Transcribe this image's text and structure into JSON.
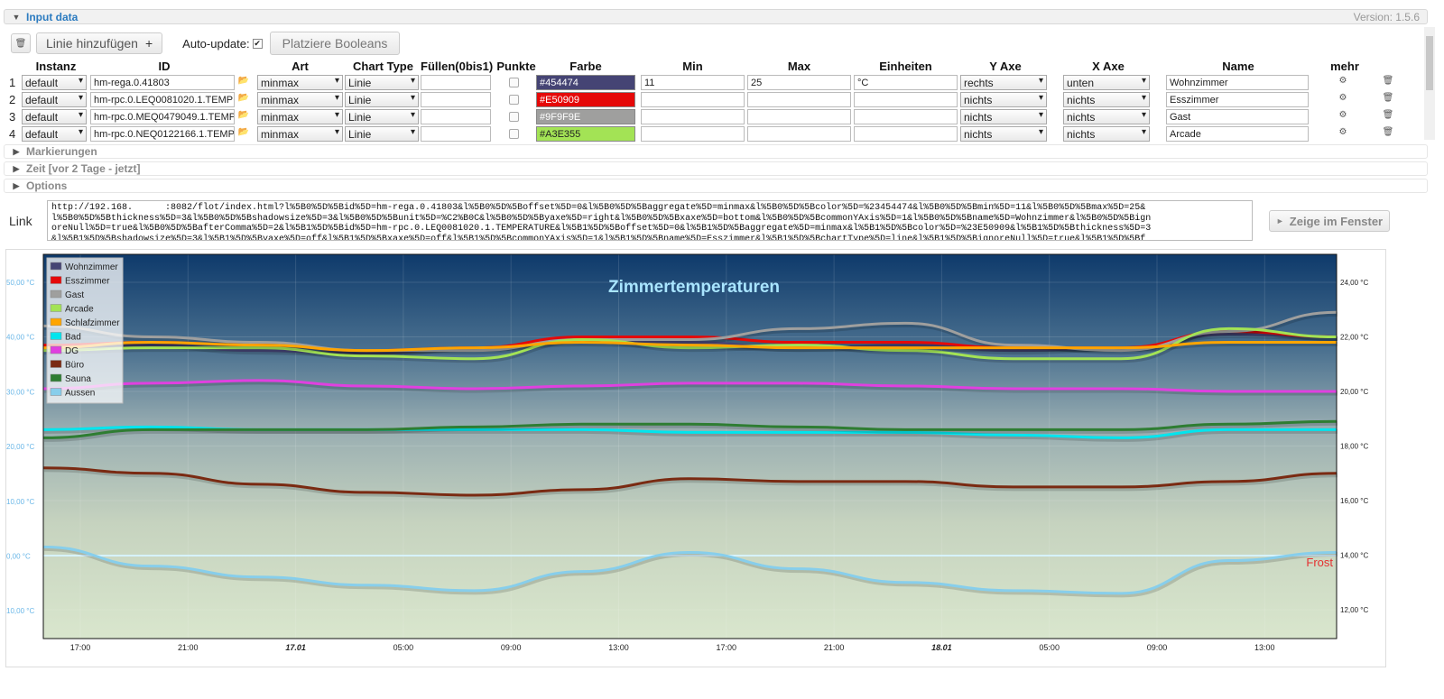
{
  "accordion": {
    "input_data": "Input data",
    "version": "Version: 1.5.6",
    "markierungen": "Markierungen",
    "zeit": "Zeit [vor 2 Tage - jetzt]",
    "options": "Options"
  },
  "toolbar": {
    "add_line": "Linie hinzufügen",
    "plus": "+",
    "auto_update_label": "Auto-update:",
    "auto_update_checked": true,
    "place_booleans": "Platziere Booleans"
  },
  "columns": [
    "Instanz",
    "ID",
    "Art",
    "Chart Type",
    "Füllen(0bis1)",
    "Punkte",
    "Farbe",
    "Min",
    "Max",
    "Einheiten",
    "Y Axe",
    "X Axe",
    "Name",
    "mehr"
  ],
  "rows": [
    {
      "num": "1",
      "instanz": "default",
      "id": "hm-rega.0.41803",
      "art": "minmax",
      "type": "Linie",
      "fill": "",
      "farbe": "#454474",
      "farbe_hex": "#454474",
      "farbe_text_color": "#ffffff",
      "min": "11",
      "max": "25",
      "einheit": "°C",
      "yaxe": "rechts",
      "xaxe": "unten",
      "name": "Wohnzimmer"
    },
    {
      "num": "2",
      "instanz": "default",
      "id": "hm-rpc.0.LEQ0081020.1.TEMPERATURE",
      "art": "minmax",
      "type": "Linie",
      "fill": "",
      "farbe": "#E50909",
      "farbe_hex": "#E50909",
      "farbe_text_color": "#ffffff",
      "min": "",
      "max": "",
      "einheit": "",
      "yaxe": "nichts",
      "xaxe": "nichts",
      "name": "Esszimmer"
    },
    {
      "num": "3",
      "instanz": "default",
      "id": "hm-rpc.0.MEQ0479049.1.TEMPERATURE",
      "art": "minmax",
      "type": "Linie",
      "fill": "",
      "farbe": "#9F9F9E",
      "farbe_hex": "#9F9F9E",
      "farbe_text_color": "#ffffff",
      "min": "",
      "max": "",
      "einheit": "",
      "yaxe": "nichts",
      "xaxe": "nichts",
      "name": "Gast"
    },
    {
      "num": "4",
      "instanz": "default",
      "id": "hm-rpc.0.NEQ0122166.1.TEMPERATURE",
      "art": "minmax",
      "type": "Linie",
      "fill": "",
      "farbe": "#A3E355",
      "farbe_hex": "#A3E355",
      "farbe_text_color": "#222222",
      "min": "",
      "max": "",
      "einheit": "",
      "yaxe": "nichts",
      "xaxe": "nichts",
      "name": "Arcade"
    }
  ],
  "link": {
    "label": "Link",
    "url": "http://192.168.      :8082/flot/index.html?l%5B0%5D%5Bid%5D=hm-rega.0.41803&l%5B0%5D%5Boffset%5D=0&l%5B0%5D%5Baggregate%5D=minmax&l%5B0%5D%5Bcolor%5D=%23454474&l%5B0%5D%5Bmin%5D=11&l%5B0%5D%5Bmax%5D=25&\nl%5B0%5D%5Bthickness%5D=3&l%5B0%5D%5Bshadowsize%5D=3&l%5B0%5D%5Bunit%5D=%C2%B0C&l%5B0%5D%5Byaxe%5D=right&l%5B0%5D%5Bxaxe%5D=bottom&l%5B0%5D%5BcommonYAxis%5D=1&l%5B0%5D%5Bname%5D=Wohnzimmer&l%5B0%5D%5Bign\noreNull%5D=true&l%5B0%5D%5BafterComma%5D=2&l%5B1%5D%5Bid%5D=hm-rpc.0.LEQ0081020.1.TEMPERATURE&l%5B1%5D%5Boffset%5D=0&l%5B1%5D%5Baggregate%5D=minmax&l%5B1%5D%5Bcolor%5D=%23E50909&l%5B1%5D%5Bthickness%5D=3\n&l%5B1%5D%5Bshadowsize%5D=3&l%5B1%5D%5Byaxe%5D=off&l%5B1%5D%5Bxaxe%5D=off&l%5B1%5D%5BcommonYAxis%5D=1&l%5B1%5D%5Bname%5D=Esszimmer&l%5B1%5D%5BchartType%5D=line&l%5B1%5D%5BignoreNull%5D=true&l%5B1%5D%5Bf",
    "show_button": "Zeige im Fenster",
    "play_icon": "►"
  },
  "chart_data": {
    "type": "line",
    "title": "Zimmertemperaturen",
    "annotation": "Frost",
    "left_axis_ticks": [
      "50,00 °C",
      "40,00 °C",
      "30,00 °C",
      "20,00 °C",
      "10,00 °C",
      "0,00 °C",
      "10,00 °C"
    ],
    "right_axis_ticks": [
      "24,00 °C",
      "22,00 °C",
      "20,00 °C",
      "18,00 °C",
      "16,00 °C",
      "14,00 °C",
      "12,00 °C"
    ],
    "right_ylim": [
      11,
      25
    ],
    "x_ticks": [
      "17:00",
      "21:00",
      "17.01",
      "05:00",
      "09:00",
      "13:00",
      "17:00",
      "21:00",
      "18.01",
      "05:00",
      "09:00",
      "13:00"
    ],
    "legend_position": "top-left",
    "series": [
      {
        "name": "Wohnzimmer",
        "color": "#454474",
        "values": [
          21.6,
          21.7,
          21.5,
          21.4,
          21.6,
          21.9,
          21.8,
          21.6,
          21.7,
          21.5,
          21.6,
          22.1,
          22.0
        ]
      },
      {
        "name": "Esszimmer",
        "color": "#E50909",
        "values": [
          21.7,
          21.8,
          21.7,
          21.5,
          21.6,
          22.0,
          22.0,
          21.8,
          21.8,
          21.6,
          21.6,
          22.2,
          22.0
        ]
      },
      {
        "name": "Gast",
        "color": "#9F9F9E",
        "values": [
          22.4,
          22.0,
          21.8,
          21.5,
          21.5,
          21.9,
          21.9,
          22.3,
          22.5,
          21.7,
          21.5,
          22.2,
          22.9
        ]
      },
      {
        "name": "Arcade",
        "color": "#A3E355",
        "values": [
          21.5,
          21.6,
          21.6,
          21.3,
          21.2,
          21.9,
          21.6,
          21.7,
          21.5,
          21.2,
          21.2,
          22.3,
          22.0
        ]
      },
      {
        "name": "Schlafzimmer",
        "color": "#FFA500",
        "values": [
          21.6,
          21.8,
          21.7,
          21.5,
          21.6,
          21.8,
          21.7,
          21.6,
          21.6,
          21.6,
          21.6,
          21.8,
          21.8
        ]
      },
      {
        "name": "Bad",
        "color": "#00E5EE",
        "values": [
          18.6,
          18.7,
          18.6,
          18.6,
          18.6,
          18.6,
          18.5,
          18.5,
          18.5,
          18.4,
          18.3,
          18.6,
          18.6
        ]
      },
      {
        "name": "DG",
        "color": "#E040E0",
        "values": [
          20.1,
          20.3,
          20.4,
          20.2,
          20.1,
          20.2,
          20.3,
          20.3,
          20.2,
          20.1,
          20.1,
          20.0,
          20.0
        ]
      },
      {
        "name": "Büro",
        "color": "#7A2A12",
        "values": [
          17.2,
          17.0,
          16.6,
          16.3,
          16.2,
          16.4,
          16.8,
          16.7,
          16.7,
          16.5,
          16.5,
          16.7,
          17.0
        ]
      },
      {
        "name": "Sauna",
        "color": "#2E7D32",
        "values": [
          18.3,
          18.6,
          18.6,
          18.6,
          18.7,
          18.8,
          18.8,
          18.7,
          18.6,
          18.6,
          18.6,
          18.8,
          18.9
        ]
      },
      {
        "name": "Aussen",
        "color": "#87CEEB",
        "values": [
          14.3,
          13.6,
          13.2,
          12.9,
          12.7,
          13.4,
          14.1,
          13.5,
          13.0,
          12.7,
          12.6,
          13.8,
          14.1
        ]
      }
    ]
  }
}
